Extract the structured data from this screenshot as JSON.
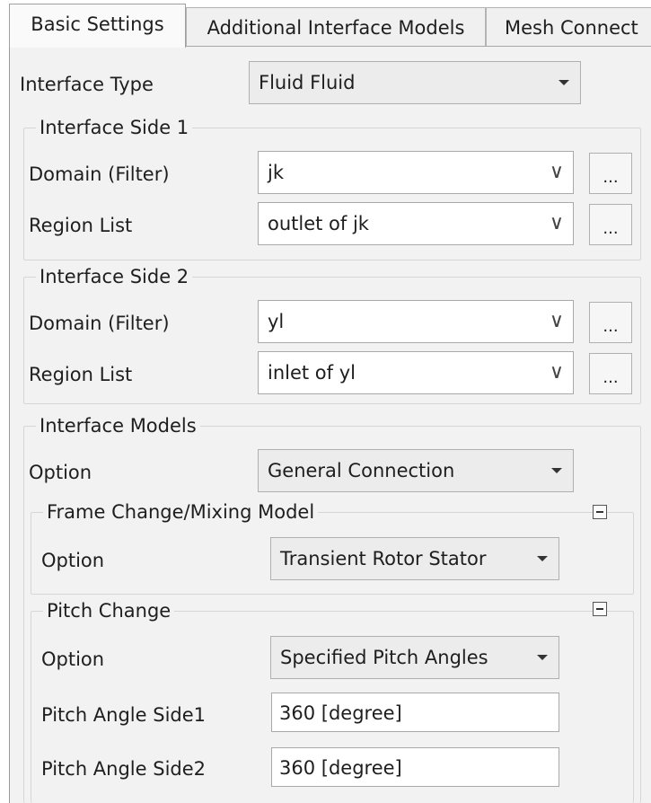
{
  "tabs": [
    {
      "label": "Basic Settings"
    },
    {
      "label": "Additional Interface Models"
    },
    {
      "label": "Mesh Connect"
    }
  ],
  "interface_type": {
    "label": "Interface Type",
    "value": "Fluid Fluid"
  },
  "side1": {
    "title": "Interface Side 1",
    "domain": {
      "label": "Domain (Filter)",
      "value": "jk"
    },
    "region": {
      "label": "Region List",
      "value": "outlet of jk"
    }
  },
  "side2": {
    "title": "Interface Side 2",
    "domain": {
      "label": "Domain (Filter)",
      "value": "yl"
    },
    "region": {
      "label": "Region List",
      "value": "inlet of yl"
    }
  },
  "ellipsis_label": "...",
  "models": {
    "title": "Interface Models",
    "option": {
      "label": "Option",
      "value": "General Connection"
    },
    "frame_change": {
      "title": "Frame Change/Mixing Model",
      "option": {
        "label": "Option",
        "value": "Transient Rotor Stator"
      }
    },
    "pitch_change": {
      "title": "Pitch Change",
      "option": {
        "label": "Option",
        "value": "Specified Pitch Angles"
      },
      "side1": {
        "label": "Pitch Angle Side1",
        "value": "360 [degree]"
      },
      "side2": {
        "label": "Pitch Angle Side2",
        "value": "360 [degree]"
      }
    }
  }
}
